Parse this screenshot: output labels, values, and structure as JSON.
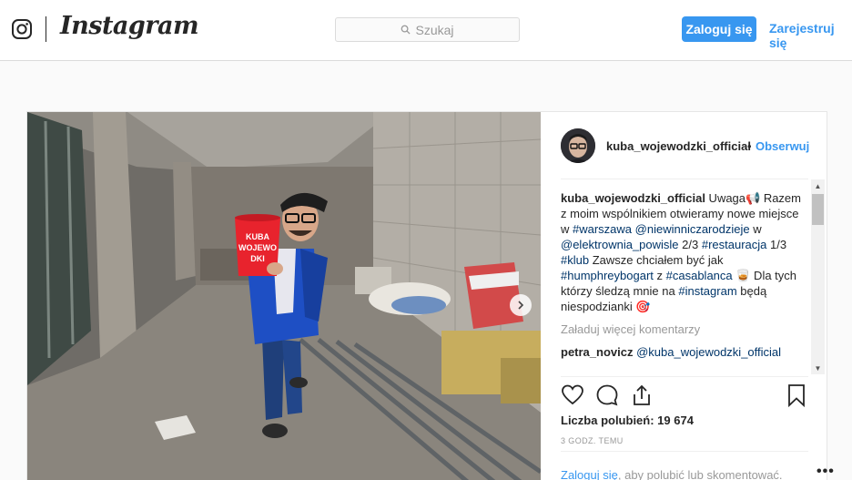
{
  "header": {
    "brand": "Instagram",
    "search_placeholder": "Szukaj",
    "login_label": "Zaloguj się",
    "register_label": "Zarejestruj się"
  },
  "post": {
    "username": "kuba_wojewodzki_official",
    "dot": "•",
    "follow_label": "Obserwuj",
    "caption": {
      "author": "kuba_wojewodzki_official",
      "parts": [
        {
          "t": "text",
          "v": " Uwaga📢 Razem z moim wspólnikiem otwieramy nowe miejsce w "
        },
        {
          "t": "tag",
          "v": "#warszawa"
        },
        {
          "t": "text",
          "v": " "
        },
        {
          "t": "tag",
          "v": "@niewinniczarodzieje"
        },
        {
          "t": "text",
          "v": " w "
        },
        {
          "t": "tag",
          "v": "@elektrownia_powisle"
        },
        {
          "t": "text",
          "v": " 2/3 "
        },
        {
          "t": "tag",
          "v": "#restauracja"
        },
        {
          "t": "text",
          "v": " 1/3 "
        },
        {
          "t": "tag",
          "v": "#klub"
        },
        {
          "t": "text",
          "v": " Zawsze chciałem być jak "
        },
        {
          "t": "tag",
          "v": "#humphreybogart"
        },
        {
          "t": "text",
          "v": " z "
        },
        {
          "t": "tag",
          "v": "#casablanca"
        },
        {
          "t": "text",
          "v": " 🥃 Dla tych którzy śledzą mnie na "
        },
        {
          "t": "tag",
          "v": "#instagram"
        },
        {
          "t": "text",
          "v": " będą niespodzianki 🎯"
        }
      ]
    },
    "load_more_label": "Załaduj więcej komentarzy",
    "second_comment": {
      "author": "petra_novicz",
      "text": "@kuba_wojewodzki_official"
    },
    "likes": "Liczba polubień: 19 674",
    "time": "3 godz. temu",
    "footer": {
      "login_link": "Zaloguj się",
      "rest": ", aby polubić lub skomentować.",
      "more": "•••"
    },
    "bucket_text": "KUBA WOJEWO DKI"
  },
  "colors": {
    "accent": "#3897f0",
    "tag": "#003569",
    "jacket": "#1e4fc4",
    "bucket": "#e8232d"
  },
  "icons": [
    "instagram-glyph-icon",
    "search-icon",
    "heart-icon",
    "comment-icon",
    "share-icon",
    "bookmark-icon",
    "chevron-right-icon",
    "scroll-up-icon",
    "scroll-down-icon"
  ]
}
